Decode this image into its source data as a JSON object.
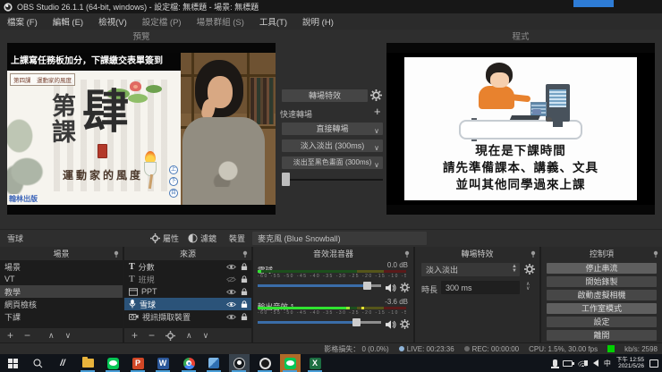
{
  "title_bar": {
    "title": "OBS Studio 26.1.1 (64-bit, windows) - 設定檔: 無標題 - 場景: 無標題"
  },
  "menu_bar": {
    "items": [
      "檔案 (F)",
      "編輯 (E)",
      "檢視(V)",
      "設定檔 (P)",
      "場景群組 (S)",
      "工具(T)",
      "說明 (H)"
    ]
  },
  "studio": {
    "preview_label": "預覽",
    "program_label": "程式",
    "preview_scene": {
      "banner": "上課寫任務板加分，下課繳交表單簽到",
      "book": {
        "lesson_tag": "第四課　運動家的風度",
        "big_char_1": "第",
        "big_char_2": "課",
        "big_char_3": "肆",
        "subtitle": "運動家的風度",
        "publisher": "翰林出版",
        "nav": [
          "上",
          "下",
          "目"
        ]
      }
    },
    "program_scene": {
      "lines": [
        "現在是下課時間",
        "請先準備課本、講義、文具",
        "並叫其他同學過來上課"
      ]
    },
    "transition_panel": {
      "transition_button": "轉場特效",
      "quick_label": "快速轉場",
      "quick_items": [
        "直接轉場",
        "淡入淡出 (300ms)",
        "淡出至黑色畫面 (300ms)"
      ]
    }
  },
  "source_toolbar": {
    "source_name": "雪球",
    "properties_label": "屬性",
    "filters_label": "濾鏡",
    "device_label": "裝置",
    "device_value": "麥克風 (Blue Snowball)"
  },
  "docks": {
    "scenes": {
      "title": "場景",
      "items": [
        "場景",
        "VT",
        "教學",
        "網頁檢核",
        "下課"
      ],
      "selected": "教學"
    },
    "sources": {
      "title": "來源",
      "items": [
        {
          "name": "分數",
          "icon": "text",
          "visible": true,
          "locked": true
        },
        {
          "name": "班規",
          "icon": "text",
          "visible": false,
          "locked": true
        },
        {
          "name": "PPT",
          "icon": "window",
          "visible": true,
          "locked": true
        },
        {
          "name": "雪球",
          "icon": "mic",
          "visible": true,
          "locked": true,
          "selected": true
        },
        {
          "name": "視訊擷取裝置",
          "icon": "camera",
          "visible": true,
          "locked": true
        }
      ]
    },
    "mixer": {
      "title": "音效混音器",
      "scale": "-60  -55  -50  -45  -40  -35  -30  -25  -20  -15  -10  -5  0",
      "channels": [
        {
          "name": "雪球",
          "db": "0.0 dB"
        },
        {
          "name": "輸出音效 1",
          "db": "-3.6 dB"
        }
      ]
    },
    "transitions": {
      "title": "轉場特效",
      "current": "淡入淡出",
      "duration_label": "時長",
      "duration_value": "300 ms"
    },
    "controls": {
      "title": "控制項",
      "buttons": [
        "停止串流",
        "開始錄製",
        "啟動虛擬相機",
        "工作室模式",
        "設定",
        "離開"
      ]
    }
  },
  "status_bar": {
    "dropped_frames": "影格損失： 0 (0.0%)",
    "live": "LIVE: 00:23:36",
    "rec": "REC: 00:00:00",
    "cpu": "CPU: 1.5%, 30.00 fps",
    "bitrate": "kb/s: 2598"
  },
  "taskbar": {
    "icon_letters": {
      "slashes": "//",
      "powerpoint": "P",
      "word": "W",
      "excel": "X"
    },
    "tray": {
      "ime": "中",
      "time": "下午 12:55",
      "date": "2021/5/26"
    }
  },
  "colors": {
    "accent_blue": "#2b5379",
    "meter_green": "#31e431",
    "live_green": "#00cf00",
    "slider_blue": "#3a6da8"
  }
}
